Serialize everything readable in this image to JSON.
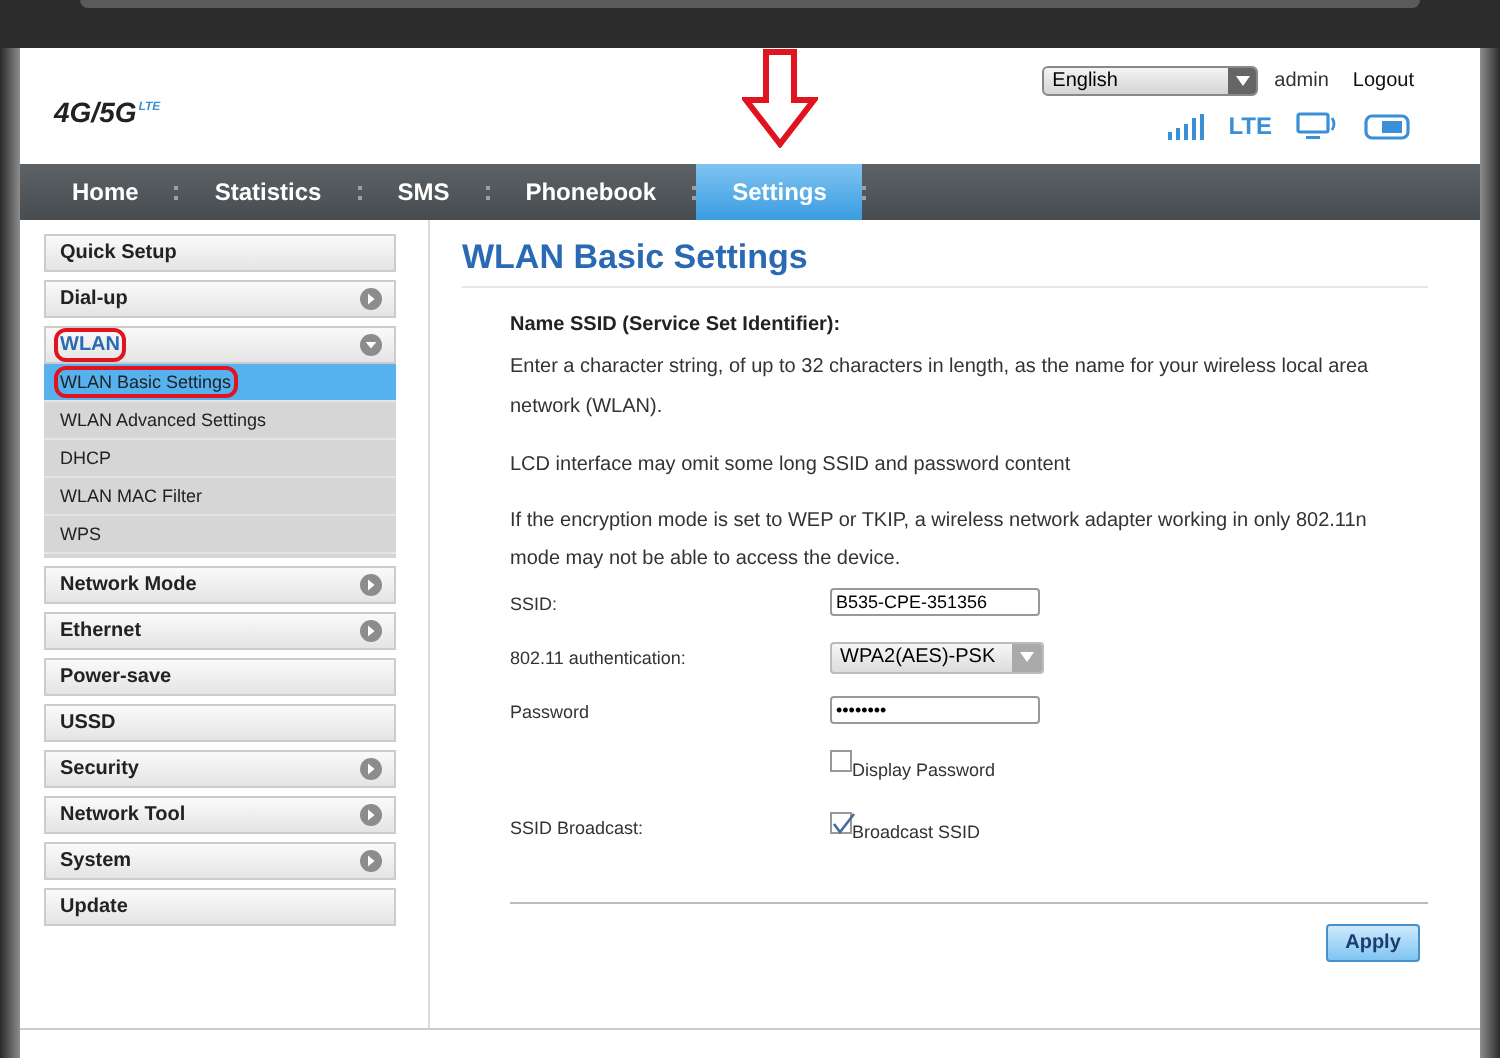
{
  "header": {
    "logo": "4G/5G",
    "logo_badge": "LTE",
    "language": "English",
    "user": "admin",
    "logout": "Logout",
    "network_type": "LTE"
  },
  "nav": [
    {
      "label": "Home",
      "selected": false
    },
    {
      "label": "Statistics",
      "selected": false
    },
    {
      "label": "SMS",
      "selected": false
    },
    {
      "label": "Phonebook",
      "selected": false
    },
    {
      "label": "Settings",
      "selected": true,
      "annotated": true
    }
  ],
  "sidebar": [
    {
      "label": "Quick Setup",
      "expandable": false,
      "expanded": false,
      "annotated": false
    },
    {
      "label": "Dial-up",
      "expandable": true,
      "expanded": false,
      "annotated": false
    },
    {
      "label": "WLAN",
      "expandable": true,
      "expanded": true,
      "annotated": true,
      "children": [
        {
          "label": "WLAN Basic Settings",
          "selected": true,
          "annotated": true
        },
        {
          "label": "WLAN Advanced Settings",
          "selected": false,
          "annotated": false
        },
        {
          "label": "DHCP",
          "selected": false,
          "annotated": false
        },
        {
          "label": "WLAN MAC Filter",
          "selected": false,
          "annotated": false
        },
        {
          "label": "WPS",
          "selected": false,
          "annotated": false
        }
      ]
    },
    {
      "label": "Network Mode",
      "expandable": true,
      "expanded": false,
      "annotated": false
    },
    {
      "label": "Ethernet",
      "expandable": true,
      "expanded": false,
      "annotated": false
    },
    {
      "label": "Power-save",
      "expandable": false,
      "expanded": false,
      "annotated": false
    },
    {
      "label": "USSD",
      "expandable": false,
      "expanded": false,
      "annotated": false
    },
    {
      "label": "Security",
      "expandable": true,
      "expanded": false,
      "annotated": false
    },
    {
      "label": "Network Tool",
      "expandable": true,
      "expanded": false,
      "annotated": false
    },
    {
      "label": "System",
      "expandable": true,
      "expanded": false,
      "annotated": false
    },
    {
      "label": "Update",
      "expandable": false,
      "expanded": false,
      "annotated": false
    }
  ],
  "content": {
    "title": "WLAN Basic Settings",
    "heading": "Name SSID (Service Set Identifier):",
    "paragraphs": [
      "Enter a character string, of up to 32 characters in length, as the name for your wireless local area network (WLAN).",
      "LCD interface may omit some long SSID and password content",
      "If the encryption mode is set to WEP or TKIP, a wireless network adapter working in only 802.11n mode may not be able to access the device."
    ],
    "fields": [
      {
        "kind": "text",
        "label": "SSID:",
        "value": "B535-CPE-351356"
      },
      {
        "kind": "select",
        "label": "802.11 authentication:",
        "value": "WPA2(AES)-PSK"
      },
      {
        "kind": "password",
        "label": "Password",
        "value": "••••••••"
      },
      {
        "kind": "checkbox",
        "option": "Display Password",
        "checked": false
      },
      {
        "kind": "checkbox",
        "label": "SSID Broadcast:",
        "option": "Broadcast SSID",
        "checked": true
      }
    ],
    "apply": "Apply"
  }
}
